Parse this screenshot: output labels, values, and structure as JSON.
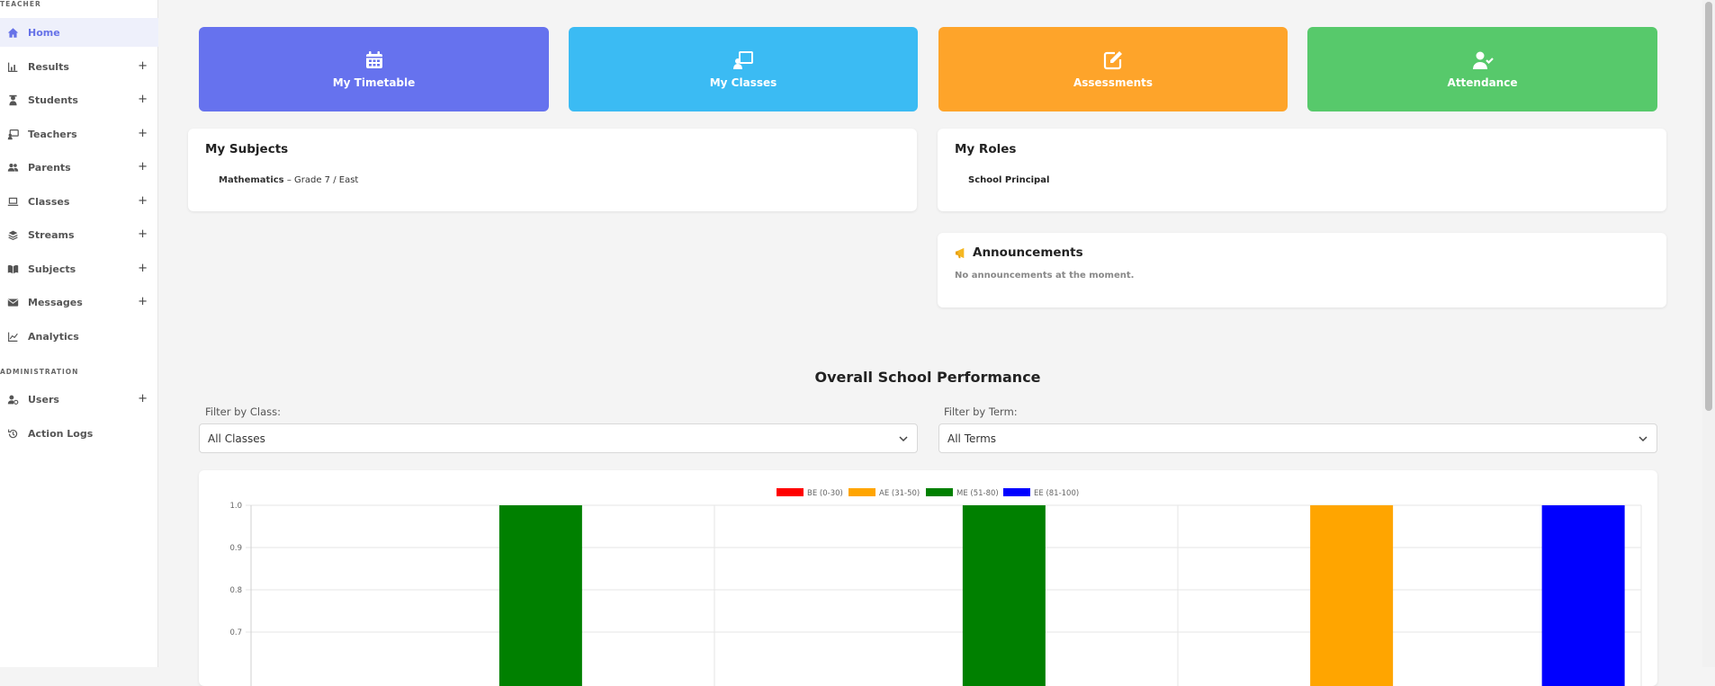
{
  "sidebar": {
    "section_teacher": "TEACHER",
    "section_admin": "ADMINISTRATION",
    "items": [
      {
        "label": "Home",
        "icon": "home-icon",
        "expandable": false
      },
      {
        "label": "Results",
        "icon": "chart-icon",
        "expandable": true
      },
      {
        "label": "Students",
        "icon": "student-icon",
        "expandable": true
      },
      {
        "label": "Teachers",
        "icon": "teacher-icon",
        "expandable": true
      },
      {
        "label": "Parents",
        "icon": "users-icon",
        "expandable": true
      },
      {
        "label": "Classes",
        "icon": "laptop-icon",
        "expandable": true
      },
      {
        "label": "Streams",
        "icon": "layers-icon",
        "expandable": true
      },
      {
        "label": "Subjects",
        "icon": "book-icon",
        "expandable": true
      },
      {
        "label": "Messages",
        "icon": "envelope-icon",
        "expandable": true
      },
      {
        "label": "Analytics",
        "icon": "line-chart-icon",
        "expandable": false
      }
    ],
    "admin_items": [
      {
        "label": "Users",
        "icon": "user-cog-icon",
        "expandable": true
      },
      {
        "label": "Action Logs",
        "icon": "history-icon",
        "expandable": false
      }
    ],
    "plus_symbol": "+"
  },
  "tiles": [
    {
      "label": "My Timetable",
      "icon": "calendar-icon",
      "color": "#6672ee"
    },
    {
      "label": "My Classes",
      "icon": "chalkboard-teacher-icon",
      "color": "#3bbbf3"
    },
    {
      "label": "Assessments",
      "icon": "edit-icon",
      "color": "#fea42a"
    },
    {
      "label": "Attendance",
      "icon": "user-check-icon",
      "color": "#57c96b"
    }
  ],
  "subjects_card": {
    "title": "My Subjects",
    "subject": "Mathematics",
    "detail": "– Grade 7 / East"
  },
  "roles_card": {
    "title": "My Roles",
    "role": "School Principal"
  },
  "announcements_card": {
    "icon": "megaphone-icon",
    "title": "Announcements",
    "empty_text": "No announcements at the moment."
  },
  "performance": {
    "heading": "Overall School Performance",
    "class_filter": {
      "label": "Filter by Class:",
      "value": "All Classes"
    },
    "term_filter": {
      "label": "Filter by Term:",
      "value": "All Terms"
    }
  },
  "chart_data": {
    "type": "bar",
    "legend": [
      {
        "name": "BE (0-30)",
        "color": "#ff0000"
      },
      {
        "name": "AE (31-50)",
        "color": "#ffa500"
      },
      {
        "name": "ME (51-80)",
        "color": "#008000"
      },
      {
        "name": "EE (81-100)",
        "color": "#0000ff"
      }
    ],
    "legend_position": "top-center",
    "yticks": [
      "1.0",
      "0.9",
      "0.8",
      "0.7"
    ],
    "ylim_visible": [
      0.65,
      1.0
    ],
    "grid": true,
    "category_count": 3,
    "bars": [
      {
        "category_index": 0,
        "series": "ME (51-80)",
        "value": 1.0
      },
      {
        "category_index": 1,
        "series": "ME (51-80)",
        "value": 1.0
      },
      {
        "category_index": 2,
        "series": "AE (31-50)",
        "value": 1.0
      },
      {
        "category_index": 2,
        "series": "EE (81-100)",
        "value": 1.0
      }
    ]
  }
}
